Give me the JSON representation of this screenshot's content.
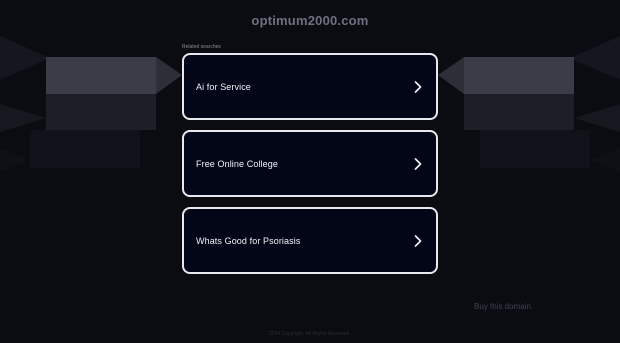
{
  "header": {
    "domain": "optimum2000.com"
  },
  "related": {
    "label": "Related searches",
    "items": [
      {
        "label": "Ai for Service"
      },
      {
        "label": "Free Online College"
      },
      {
        "label": "Whats Good for Psoriasis"
      }
    ]
  },
  "sidebar_link": {
    "label": "Buy this domain."
  },
  "footer": {
    "text": "2024 Copyright. All Rights Reserved."
  },
  "colors": {
    "background": "#0b0c12",
    "card_background": "#020617",
    "card_border": "#e8e9ee",
    "text": "#f2f3f7"
  }
}
